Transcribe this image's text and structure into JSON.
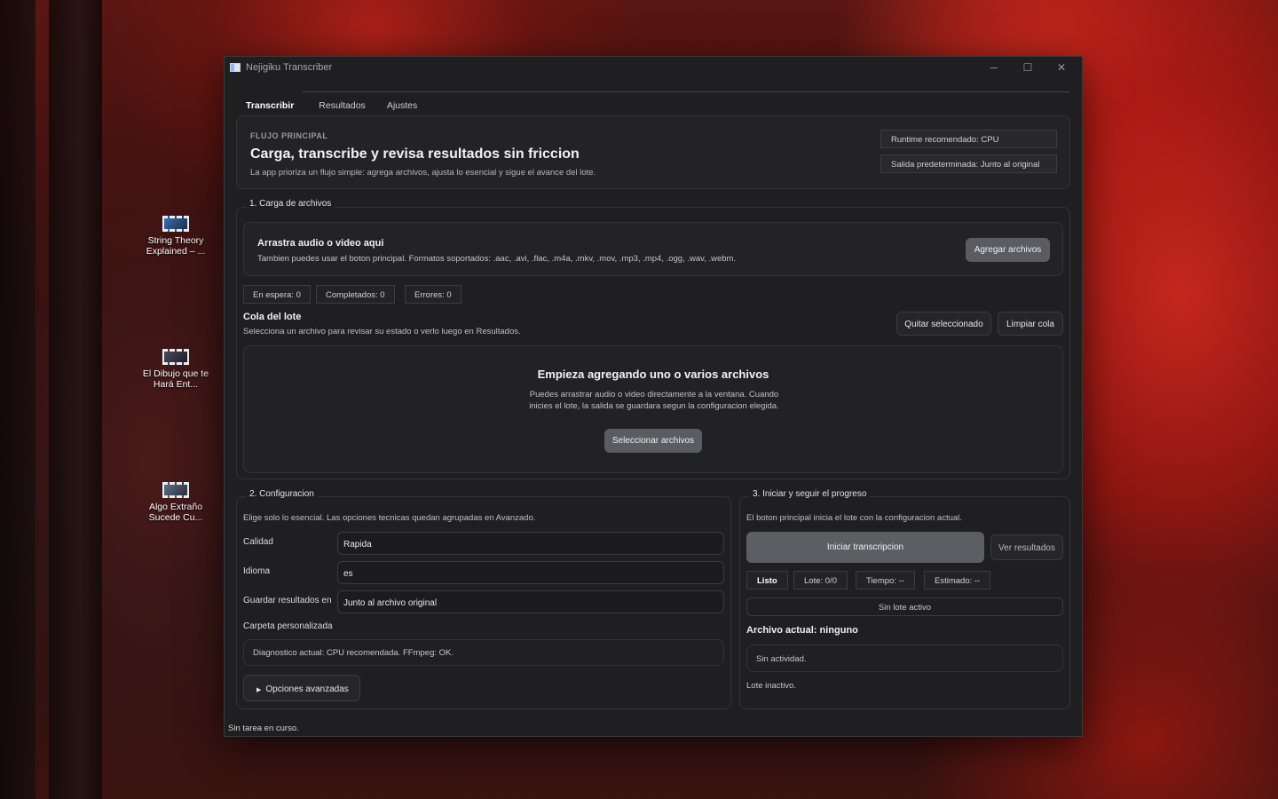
{
  "desktop": {
    "icons": [
      {
        "label": "String Theory Explained – ..."
      },
      {
        "label": "El Dibujo que te Hará Ent..."
      },
      {
        "label": "Algo Extraño Sucede Cu..."
      }
    ]
  },
  "window": {
    "title": "Nejigiku Transcriber",
    "controls": {
      "minimize": "─",
      "maximize": "☐",
      "close": "✕"
    }
  },
  "tabs": [
    {
      "label": "Transcribir",
      "active": true
    },
    {
      "label": "Resultados",
      "active": false
    },
    {
      "label": "Ajustes",
      "active": false
    }
  ],
  "hero": {
    "eyebrow": "FLUJO PRINCIPAL",
    "title": "Carga, transcribe y revisa resultados sin friccion",
    "subtitle": "La app prioriza un flujo simple: agrega archivos, ajusta lo esencial y sigue el avance del lote.",
    "runtime": "Runtime recomendado: CPU",
    "output": "Salida predeterminada: Junto al original"
  },
  "upload": {
    "section_label": "1. Carga de archivos",
    "drop_title": "Arrastra audio o video aqui",
    "drop_sub": "Tambien puedes usar el boton principal. Formatos soportados: .aac, .avi, .flac, .m4a, .mkv, .mov, .mp3, .mp4, .ogg, .wav, .webm.",
    "add_button": "Agregar archivos",
    "counters": {
      "waiting": "En espera: 0",
      "completed": "Completados: 0",
      "errors": "Errores: 0"
    },
    "queue_title": "Cola del lote",
    "queue_sub": "Selecciona un archivo para revisar su estado o verlo luego en Resultados.",
    "remove_button": "Quitar seleccionado",
    "clear_button": "Limpiar cola",
    "empty_title": "Empieza agregando uno o varios archivos",
    "empty_sub": "Puedes arrastrar audio o video directamente a la ventana. Cuando inicies el lote, la salida se guardara segun la configuracion elegida.",
    "select_button": "Seleccionar archivos"
  },
  "config": {
    "section_label": "2. Configuracion",
    "intro": "Elige solo lo esencial. Las opciones tecnicas quedan agrupadas en Avanzado.",
    "quality_label": "Calidad",
    "quality_value": "Rapida",
    "language_label": "Idioma",
    "language_value": "es",
    "save_label": "Guardar resultados en",
    "save_value": "Junto al archivo original",
    "custom_folder_label": "Carpeta personalizada",
    "diagnostic": "Diagnostico actual: CPU recomendada. FFmpeg: OK.",
    "advanced_button": "Opciones avanzadas"
  },
  "progress": {
    "section_label": "3. Iniciar y seguir el progreso",
    "intro": "El boton principal inicia el lote con la configuracion actual.",
    "start_button": "Iniciar transcripcion",
    "results_button": "Ver resultados",
    "chips": {
      "status": "Listo",
      "batch": "Lote: 0/0",
      "time": "Tiempo: --",
      "eta": "Estimado: --"
    },
    "batch_bar": "Sin lote activo",
    "current_file": "Archivo actual: ninguno",
    "activity": "Sin actividad.",
    "batch_state": "Lote inactivo."
  },
  "status_bar": "Sin tarea en curso."
}
